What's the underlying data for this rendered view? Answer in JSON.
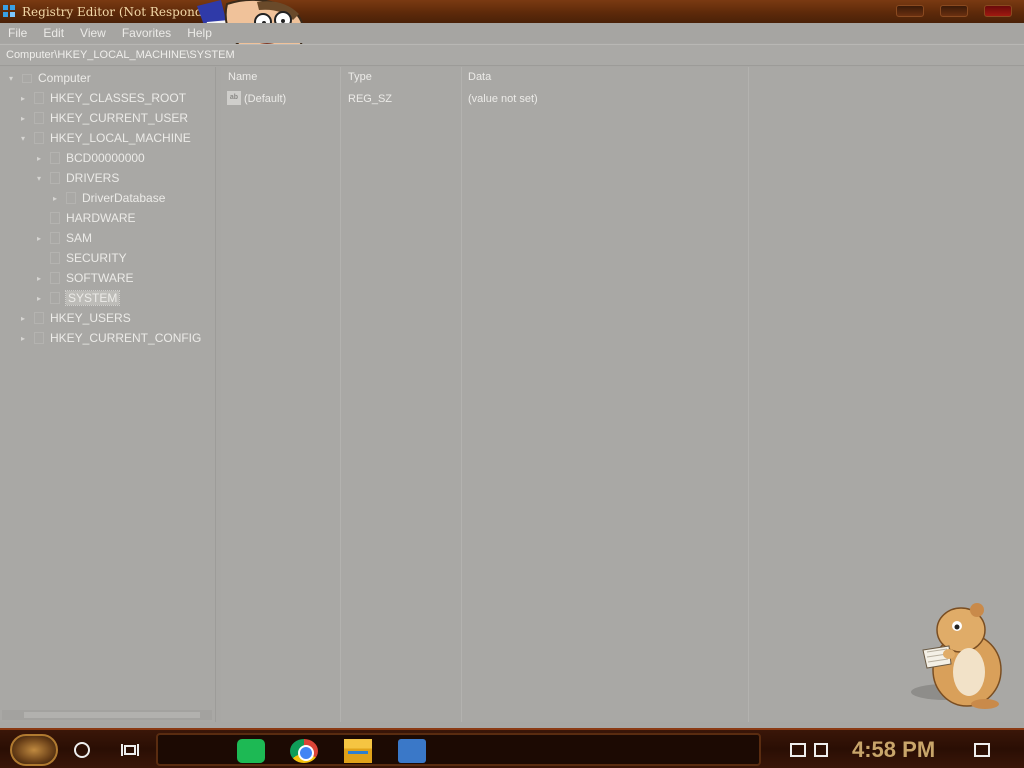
{
  "window": {
    "title": "Registry Editor (Not Respondi",
    "accent": "#5e2a0a"
  },
  "menu": [
    "File",
    "Edit",
    "View",
    "Favorites",
    "Help"
  ],
  "address": "Computer\\HKEY_LOCAL_MACHINE\\SYSTEM",
  "tree": [
    {
      "label": "Computer",
      "expander": "▾"
    },
    {
      "label": "HKEY_CLASSES_ROOT",
      "expander": "▸"
    },
    {
      "label": "HKEY_CURRENT_USER",
      "expander": "▸"
    },
    {
      "label": "HKEY_LOCAL_MACHINE",
      "expander": "▾"
    },
    {
      "label": "BCD00000000",
      "expander": "▸"
    },
    {
      "label": "DRIVERS",
      "expander": "▾"
    },
    {
      "label": "DriverDatabase",
      "expander": "▸"
    },
    {
      "label": "HARDWARE",
      "expander": ""
    },
    {
      "label": "SAM",
      "expander": "▸"
    },
    {
      "label": "SECURITY",
      "expander": ""
    },
    {
      "label": "SOFTWARE",
      "expander": "▸"
    },
    {
      "label": "SYSTEM",
      "expander": "▸",
      "selected": true
    },
    {
      "label": "HKEY_USERS",
      "expander": "▸"
    },
    {
      "label": "HKEY_CURRENT_CONFIG",
      "expander": "▸"
    }
  ],
  "list": {
    "columns": [
      "Name",
      "Type",
      "Data"
    ],
    "rows": [
      {
        "icon": "ab",
        "name": "(Default)",
        "type": "REG_SZ",
        "data": "(value not set)"
      }
    ]
  },
  "taskbar": {
    "apps": [
      "spotify-icon",
      "chrome-icon",
      "file-explorer-icon",
      "regedit-icon"
    ],
    "clock": "4:58 PM"
  }
}
